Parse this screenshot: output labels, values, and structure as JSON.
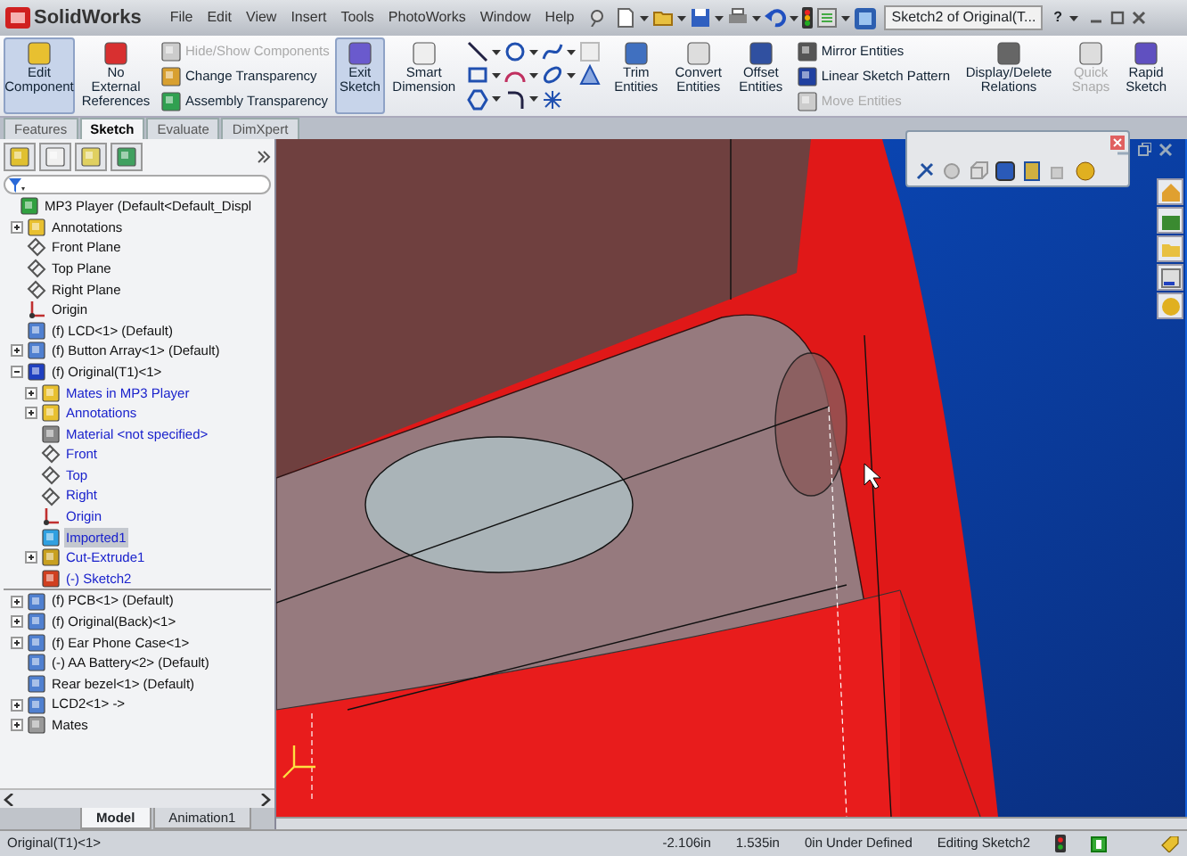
{
  "app": {
    "logo": "SolidWorks",
    "menu": [
      "File",
      "Edit",
      "View",
      "Insert",
      "Tools",
      "PhotoWorks",
      "Window",
      "Help"
    ],
    "doc_title": "Sketch2 of Original(T...",
    "help_glyph": "?"
  },
  "ribbon": {
    "component_buttons": [
      {
        "label": "Edit Component",
        "pressed": true
      },
      {
        "label": "No External References",
        "pressed": false
      }
    ],
    "component_small": [
      {
        "label": "Hide/Show Components",
        "disabled": true
      },
      {
        "label": "Change Transparency",
        "disabled": false
      },
      {
        "label": "Assembly Transparency",
        "disabled": false
      }
    ],
    "sketch_buttons": [
      {
        "label": "Exit Sketch",
        "pressed": true
      },
      {
        "label": "Smart Dimension",
        "pressed": false
      }
    ],
    "entity_buttons": [
      {
        "label": "Trim Entities"
      },
      {
        "label": "Convert Entities"
      },
      {
        "label": "Offset Entities"
      }
    ],
    "pattern_small": [
      {
        "label": "Mirror Entities",
        "disabled": false
      },
      {
        "label": "Linear Sketch Pattern",
        "disabled": false
      },
      {
        "label": "Move Entities",
        "disabled": true
      }
    ],
    "relation_buttons": [
      {
        "label": "Display/Delete Relations",
        "disabled": false
      },
      {
        "label": "Quick Snaps",
        "disabled": true
      },
      {
        "label": "Rapid Sketch",
        "disabled": false
      }
    ]
  },
  "command_tabs": [
    {
      "label": "Features",
      "selected": false
    },
    {
      "label": "Sketch",
      "selected": true
    },
    {
      "label": "Evaluate",
      "selected": false
    },
    {
      "label": "DimXpert",
      "selected": false
    }
  ],
  "tree": {
    "root": {
      "label": "MP3 Player  (Default<Default_Displ",
      "kind": "assembly",
      "selected": false,
      "children": [
        {
          "label": "Annotations",
          "kind": "annotations",
          "expanded": false,
          "selected": false
        },
        {
          "label": "Front Plane",
          "kind": "plane",
          "selected": false
        },
        {
          "label": "Top Plane",
          "kind": "plane",
          "selected": false
        },
        {
          "label": "Right Plane",
          "kind": "plane",
          "selected": false
        },
        {
          "label": "Origin",
          "kind": "origin",
          "selected": false
        },
        {
          "label": "(f) LCD<1> (Default)",
          "kind": "part",
          "selected": false
        },
        {
          "label": "(f) Button Array<1> (Default)",
          "kind": "part",
          "expanded": false,
          "selected": false
        },
        {
          "label": "(f) Original(T1)<1>",
          "kind": "editing",
          "expanded": true,
          "selected": false,
          "children": [
            {
              "label": "Mates in MP3 Player",
              "kind": "mates-folder",
              "expanded": false,
              "selected": false
            },
            {
              "label": "Annotations",
              "kind": "annotations",
              "expanded": false,
              "selected": false
            },
            {
              "label": "Material <not specified>",
              "kind": "material",
              "selected": false
            },
            {
              "label": "Front",
              "kind": "plane",
              "selected": false
            },
            {
              "label": "Top",
              "kind": "plane",
              "selected": false
            },
            {
              "label": "Right",
              "kind": "plane",
              "selected": false
            },
            {
              "label": "Origin",
              "kind": "origin",
              "selected": false
            },
            {
              "label": "Imported1",
              "kind": "imported",
              "selected": true
            },
            {
              "label": "Cut-Extrude1",
              "kind": "cut",
              "expanded": false,
              "selected": false
            },
            {
              "label": "(-) Sketch2",
              "kind": "sketch",
              "selected": false
            }
          ]
        },
        {
          "label": "(f) PCB<1> (Default)",
          "kind": "part",
          "expanded": false,
          "selected": false
        },
        {
          "label": "(f) Original(Back)<1>",
          "kind": "part",
          "expanded": false,
          "selected": false
        },
        {
          "label": "(f) Ear Phone Case<1>",
          "kind": "part",
          "expanded": false,
          "selected": false
        },
        {
          "label": "(-) AA Battery<2> (Default)",
          "kind": "part",
          "selected": false
        },
        {
          "label": "Rear bezel<1> (Default)",
          "kind": "part",
          "selected": false
        },
        {
          "label": "LCD2<1> ->",
          "kind": "part",
          "expanded": false,
          "selected": false
        },
        {
          "label": "Mates",
          "kind": "mates",
          "expanded": false,
          "selected": false
        }
      ]
    }
  },
  "model_tabs": [
    {
      "label": "Model",
      "selected": true
    },
    {
      "label": "Animation1",
      "selected": false
    }
  ],
  "status_bar": {
    "component": "Original(T1)<1>",
    "x": "-2.106in",
    "y": "1.535in",
    "z": "0in",
    "state": "Under Defined",
    "mode": "Editing Sketch2"
  }
}
